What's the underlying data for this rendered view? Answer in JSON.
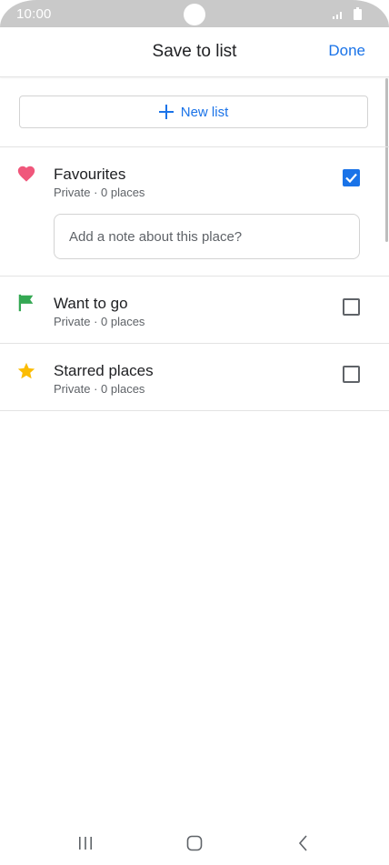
{
  "status_bar": {
    "time": "10:00"
  },
  "header": {
    "title": "Save to list",
    "done_label": "Done"
  },
  "new_list": {
    "label": "New list"
  },
  "lists": [
    {
      "title": "Favourites",
      "subtitle": "Private · 0 places",
      "icon": "heart-icon",
      "icon_color": "#f0577b",
      "checked": true
    },
    {
      "title": "Want to go",
      "subtitle": "Private · 0 places",
      "icon": "flag-icon",
      "icon_color": "#34a853",
      "checked": false
    },
    {
      "title": "Starred places",
      "subtitle": "Private · 0 places",
      "icon": "star-icon",
      "icon_color": "#fbbc04",
      "checked": false
    }
  ],
  "note": {
    "placeholder": "Add a note about this place?"
  },
  "colors": {
    "accent": "#1a73e8"
  },
  "nav_bar": {
    "buttons": [
      "recent-apps-icon",
      "home-icon",
      "back-icon"
    ]
  }
}
